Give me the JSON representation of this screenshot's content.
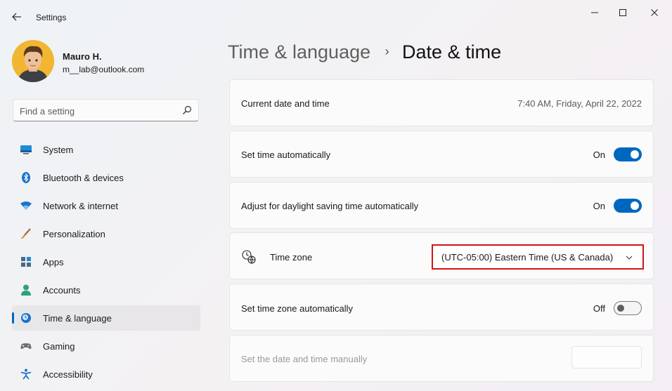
{
  "window": {
    "title": "Settings"
  },
  "user": {
    "name": "Mauro H.",
    "email": "m__lab@outlook.com"
  },
  "search": {
    "placeholder": "Find a setting"
  },
  "sidebar": {
    "items": [
      {
        "label": "System",
        "icon": "monitor-icon"
      },
      {
        "label": "Bluetooth & devices",
        "icon": "bluetooth-icon"
      },
      {
        "label": "Network & internet",
        "icon": "wifi-icon"
      },
      {
        "label": "Personalization",
        "icon": "brush-icon"
      },
      {
        "label": "Apps",
        "icon": "apps-icon"
      },
      {
        "label": "Accounts",
        "icon": "person-icon"
      },
      {
        "label": "Time & language",
        "icon": "clock-globe-icon",
        "active": true
      },
      {
        "label": "Gaming",
        "icon": "gamepad-icon"
      },
      {
        "label": "Accessibility",
        "icon": "accessibility-icon"
      }
    ]
  },
  "breadcrumb": {
    "parent": "Time & language",
    "separator": "›",
    "current": "Date & time"
  },
  "settings": {
    "current_datetime": {
      "label": "Current date and time",
      "value": "7:40 AM, Friday, April 22, 2022"
    },
    "set_time_auto": {
      "label": "Set time automatically",
      "state": "On"
    },
    "daylight_saving": {
      "label": "Adjust for daylight saving time automatically",
      "state": "On"
    },
    "time_zone": {
      "label": "Time zone",
      "selected": "(UTC-05:00) Eastern Time (US & Canada)"
    },
    "set_timezone_auto": {
      "label": "Set time zone automatically",
      "state": "Off"
    },
    "manual_datetime": {
      "label": "Set the date and time manually"
    }
  },
  "colors": {
    "accent": "#0067c0",
    "highlight_border": "#d01515"
  }
}
